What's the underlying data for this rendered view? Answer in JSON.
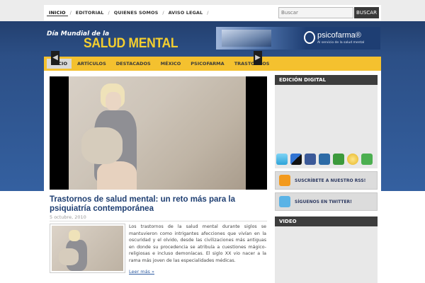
{
  "top_nav": {
    "items": [
      "Inicio",
      "Editorial",
      "Quienes somos",
      "Aviso legal"
    ],
    "separator": "/"
  },
  "search": {
    "placeholder": "Buscar",
    "button_label": "BUSCAR"
  },
  "header": {
    "logo_line1": "Día Mundial de la",
    "logo_line2": "SALUD MENTAL",
    "banner": {
      "brand": "psicofarma®",
      "tagline": "Al servicio de la salud mental"
    }
  },
  "main_nav": {
    "items": [
      "Inicio",
      "Artículos",
      "Destacados",
      "México",
      "Psicofarma",
      "Trastornos"
    ],
    "active_index": 0
  },
  "slider": {
    "prev_icon": "◀",
    "next_icon": "▶"
  },
  "post": {
    "title": "Trastornos de salud mental: un reto más para la psiquiatría contemporánea",
    "date": "5 octubre, 2010",
    "excerpt": "Los trastornos de la salud mental durante siglos se mantuvieron como intrigantes afecciones que vivían en la oscuridad y el olvido, desde las civilizaciones más antiguas en donde su procedencia se atribuía a cuestiones mágico-religiosas e incluso demoníacas. El siglo XX vio nacer a la rama más joven de las especialidades médicas.",
    "read_more": "Leer más »"
  },
  "sidebar": {
    "edicion_title": "Edición digital",
    "social_icons": [
      "twitter-icon",
      "delicious-icon",
      "facebook-icon",
      "digg-icon",
      "stumbleupon-icon",
      "favorite-star-icon",
      "add-icon"
    ],
    "rss_label": "Suscríbete a nuestro RSS!",
    "twitter_label": "Síguenos en Twitter!",
    "video_title": "Video"
  },
  "colors": {
    "header_blue": "#2c4f86",
    "nav_yellow": "#f4c12f",
    "logo_yellow": "#f5cf2e",
    "title_blue": "#1f3f72",
    "sidebar_header": "#3d3d3d"
  }
}
